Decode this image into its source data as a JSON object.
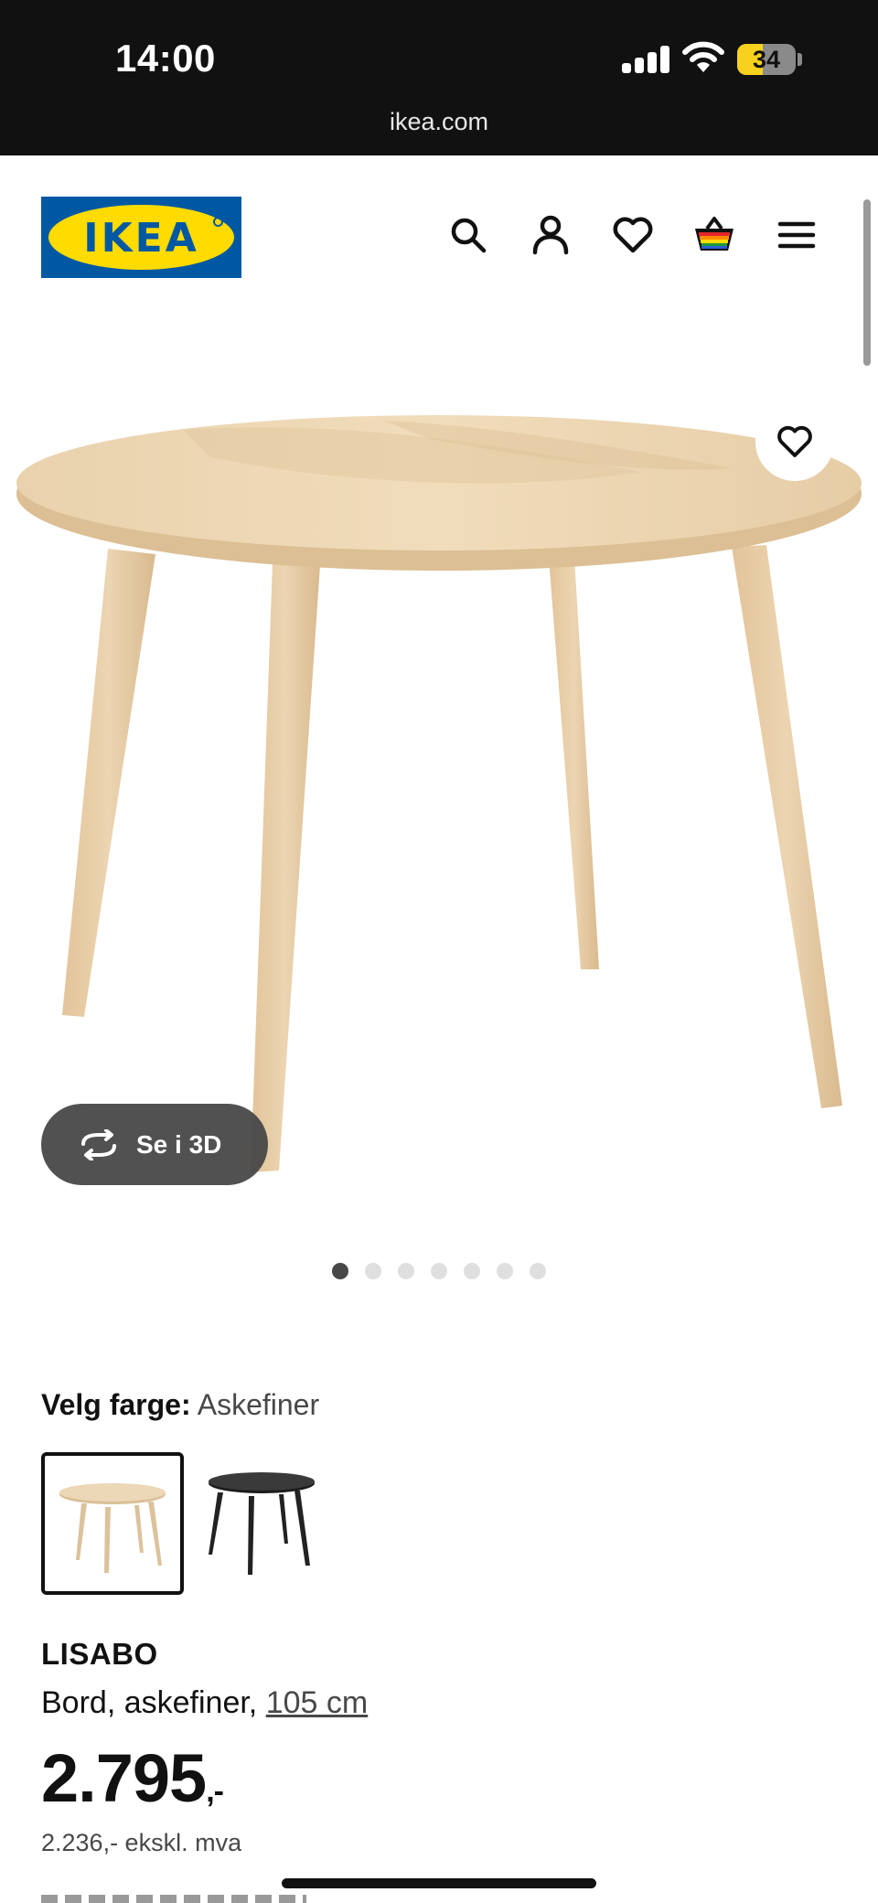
{
  "status_bar": {
    "time": "14:00",
    "battery": "34",
    "battery_level": 0.34,
    "url": "ikea.com"
  },
  "header": {
    "logo_text": "IKEA",
    "brand_colors": {
      "blue": "#0058a3",
      "yellow": "#ffdb00"
    },
    "icons": [
      "search-icon",
      "account-icon",
      "favourites-icon",
      "basket-icon",
      "menu-icon"
    ]
  },
  "gallery": {
    "view_3d_label": "Se i 3D",
    "image_count": 7,
    "active_index": 0
  },
  "product": {
    "color_label": "Velg farge:",
    "color_value": "Askefiner",
    "swatches": [
      "ash-veneer",
      "black-brown"
    ],
    "selected_swatch": 0,
    "name": "LISABO",
    "description": "Bord, askefiner,",
    "size": "105 cm",
    "price": "2.795",
    "price_suffix": ",-",
    "price_ex_vat": "2.236,- ekskl. mva"
  }
}
